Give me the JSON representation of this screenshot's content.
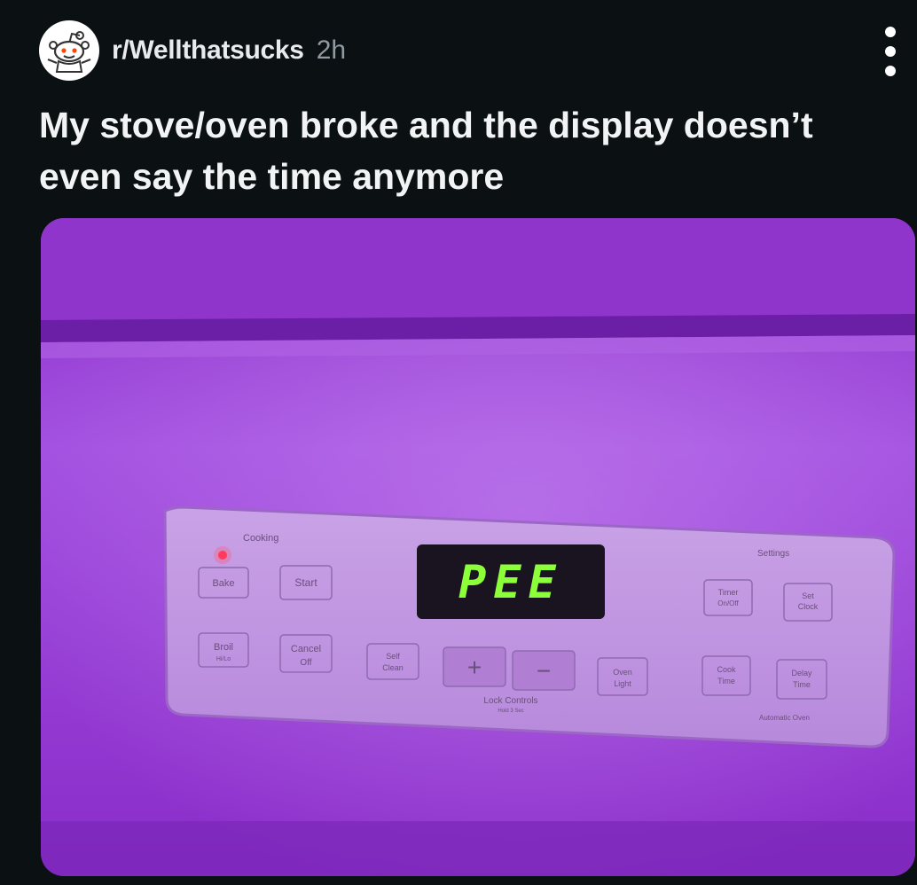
{
  "post": {
    "subreddit": "r/Wellthatsucks",
    "age": "2h",
    "title": "My stove/oven broke and the display doesn’t even say the time anymore",
    "avatar_icon": "reddit-snoo-icon",
    "menu_icon": "more-vertical-icon"
  },
  "photo": {
    "display_text": "PEE",
    "panel": {
      "cooking_label": "Cooking",
      "settings_label": "Settings",
      "bake": "Bake",
      "start": "Start",
      "broil": "Broil",
      "broil_sub": "Hi/Lo",
      "cancel": "Cancel",
      "off": "Off",
      "self_clean_1": "Self",
      "self_clean_2": "Clean",
      "plus": "+",
      "minus": "−",
      "lock_controls": "Lock Controls",
      "hold": "Hold 3 Sec",
      "oven_light_1": "Oven",
      "oven_light_2": "Light",
      "timer_1": "Timer",
      "timer_2": "On/Off",
      "set_clock_1": "Set",
      "set_clock_2": "Clock",
      "cook_time_1": "Cook",
      "cook_time_2": "Time",
      "delay_time_1": "Delay",
      "delay_time_2": "Time",
      "automatic_oven": "Automatic Oven"
    }
  },
  "colors": {
    "background": "#0b1013",
    "display_digits": "#8cff3a",
    "photo_tint": "#9a3fd0"
  }
}
